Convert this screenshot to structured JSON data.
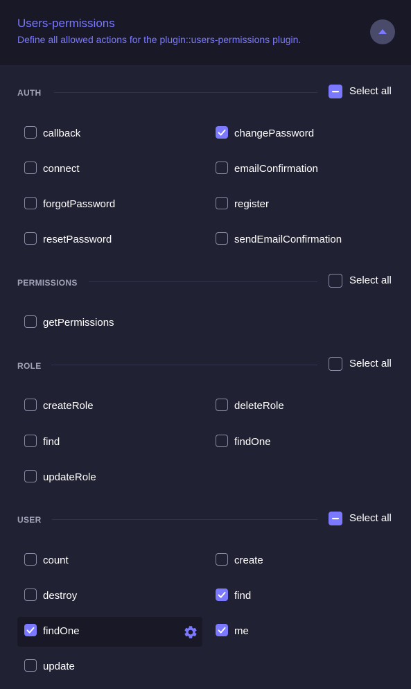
{
  "header": {
    "title": "Users-permissions",
    "subtitle": "Define all allowed actions for the plugin::users-permissions plugin.",
    "collapse_icon": "chevron-up-icon"
  },
  "colors": {
    "accent": "#7b79ff",
    "background": "#212134",
    "header_bg": "#181826"
  },
  "sections": [
    {
      "label": "AUTH",
      "select_all_label": "Select all",
      "select_all_state": "indeterminate",
      "actions": [
        {
          "label": "callback",
          "checked": false
        },
        {
          "label": "changePassword",
          "checked": true
        },
        {
          "label": "connect",
          "checked": false
        },
        {
          "label": "emailConfirmation",
          "checked": false
        },
        {
          "label": "forgotPassword",
          "checked": false
        },
        {
          "label": "register",
          "checked": false
        },
        {
          "label": "resetPassword",
          "checked": false
        },
        {
          "label": "sendEmailConfirmation",
          "checked": false
        }
      ]
    },
    {
      "label": "PERMISSIONS",
      "select_all_label": "Select all",
      "select_all_state": "unchecked",
      "actions": [
        {
          "label": "getPermissions",
          "checked": false
        }
      ]
    },
    {
      "label": "ROLE",
      "select_all_label": "Select all",
      "select_all_state": "unchecked",
      "actions": [
        {
          "label": "createRole",
          "checked": false
        },
        {
          "label": "deleteRole",
          "checked": false
        },
        {
          "label": "find",
          "checked": false
        },
        {
          "label": "findOne",
          "checked": false
        },
        {
          "label": "updateRole",
          "checked": false
        }
      ]
    },
    {
      "label": "USER",
      "select_all_label": "Select all",
      "select_all_state": "indeterminate",
      "actions": [
        {
          "label": "count",
          "checked": false
        },
        {
          "label": "create",
          "checked": false
        },
        {
          "label": "destroy",
          "checked": false
        },
        {
          "label": "find",
          "checked": true
        },
        {
          "label": "findOne",
          "checked": true,
          "highlighted": true,
          "icon": "gear-icon"
        },
        {
          "label": "me",
          "checked": true
        },
        {
          "label": "update",
          "checked": false
        }
      ]
    }
  ]
}
